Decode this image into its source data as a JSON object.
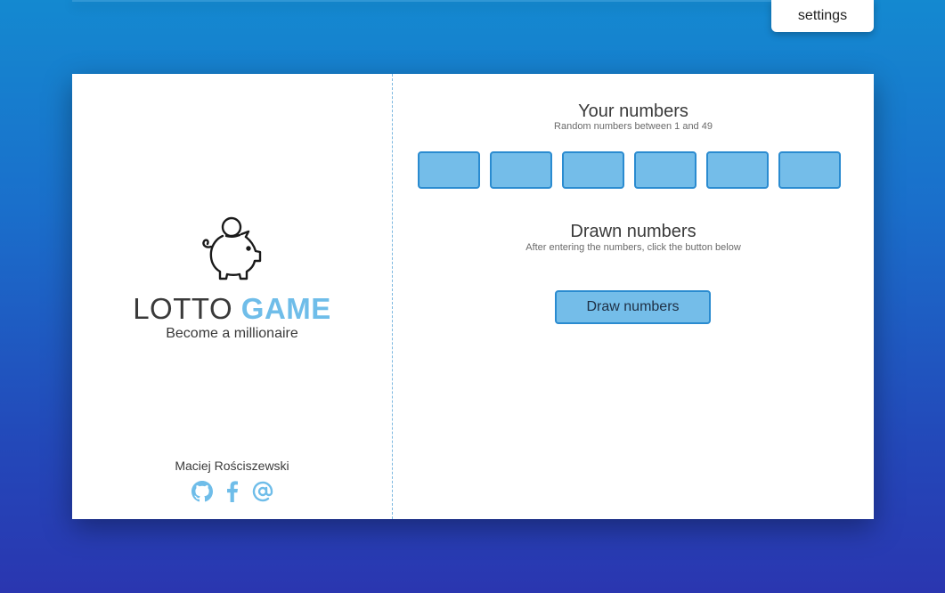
{
  "header": {
    "settings_label": "settings"
  },
  "brand": {
    "title_main": "LOTTO",
    "title_accent": "GAME",
    "subtitle": "Become a millionaire",
    "logo_icon": "piggy-bank-icon"
  },
  "footer": {
    "author": "Maciej Rościszewski",
    "socials": [
      {
        "icon": "github-icon"
      },
      {
        "icon": "facebook-icon"
      },
      {
        "icon": "email-icon"
      }
    ]
  },
  "your_numbers": {
    "heading": "Your numbers",
    "hint": "Random numbers between 1 and 49",
    "inputs": [
      "",
      "",
      "",
      "",
      "",
      ""
    ]
  },
  "drawn_numbers": {
    "heading": "Drawn numbers",
    "hint": "After entering the numbers, click the button below"
  },
  "draw_button_label": "Draw numbers",
  "colors": {
    "accent": "#6fbde9",
    "input_fill": "#74bde9",
    "input_border": "#2a8bd0",
    "background_top": "#1489d0",
    "background_bottom": "#2a36b0"
  }
}
